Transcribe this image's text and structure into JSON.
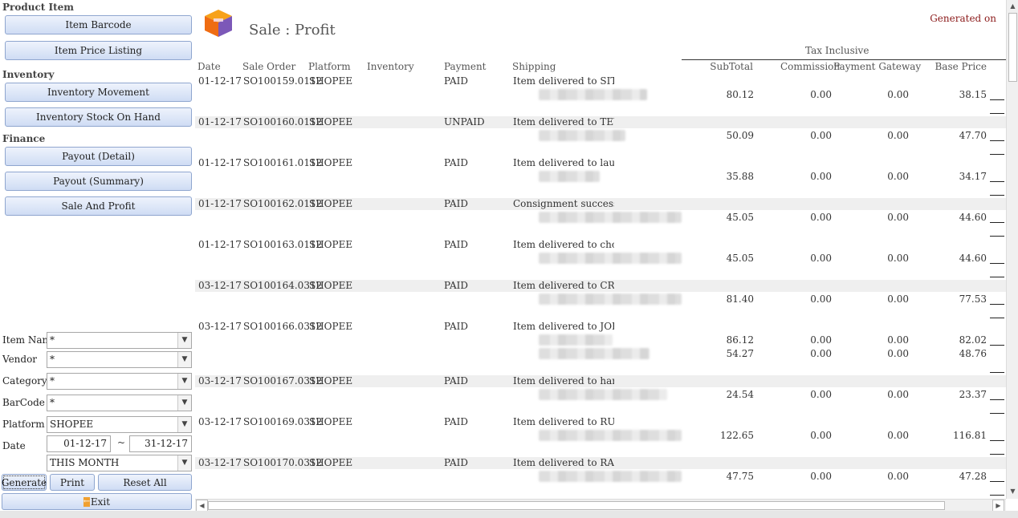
{
  "sidebar": {
    "sections": {
      "product_item": "Product Item",
      "inventory": "Inventory",
      "finance": "Finance"
    },
    "buttons": {
      "item_barcode": "Item Barcode",
      "item_price_listing": "Item Price Listing",
      "inventory_movement": "Inventory Movement",
      "inventory_stock_on_hand": "Inventory Stock On Hand",
      "payout_detail": "Payout (Detail)",
      "payout_summary": "Payout (Summary)",
      "sale_and_profit": "Sale And Profit"
    },
    "filters": {
      "item_name": {
        "label": "Item Name",
        "value": "*"
      },
      "vendor": {
        "label": "Vendor",
        "value": "*"
      },
      "category": {
        "label": "Category",
        "value": "*"
      },
      "barcode": {
        "label": "BarCode",
        "value": "*"
      },
      "platform": {
        "label": "Platform",
        "value": "SHOPEE"
      },
      "date": {
        "label": "Date",
        "from": "01-12-17",
        "to": "31-12-17",
        "separator": "~"
      },
      "period": {
        "value": "THIS MONTH"
      }
    },
    "actions": {
      "generate": "Generate",
      "print": "Print",
      "reset_all": "Reset All",
      "exit": "Exit"
    }
  },
  "report": {
    "title": "Sale : Profit",
    "generated_on": "Generated on",
    "tax_inclusive": "Tax Inclusive",
    "columns": {
      "date": "Date",
      "sale_order": "Sale Order",
      "platform": "Platform",
      "inventory": "Inventory",
      "payment": "Payment",
      "shipping": "Shipping",
      "subtotal": "SubTotal",
      "commission": "Commission",
      "payment_gateway": "Payment Gateway",
      "base_price": "Base Price"
    },
    "rows": [
      {
        "date": "01-12-17",
        "order": "SO100159.0112",
        "platform": "SHOPEE",
        "payment": "PAID",
        "shipping": "Item delivered to SITI NU",
        "subtotal": "80.12",
        "commission": "0.00",
        "gateway": "0.00",
        "base": "38.15"
      },
      {
        "date": "01-12-17",
        "order": "SO100160.0112",
        "platform": "SHOPEE",
        "payment": "UNPAID",
        "shipping": "Item delivered to TEY LA",
        "subtotal": "50.09",
        "commission": "0.00",
        "gateway": "0.00",
        "base": "47.70"
      },
      {
        "date": "01-12-17",
        "order": "SO100161.0112",
        "platform": "SHOPEE",
        "payment": "PAID",
        "shipping": "Item delivered to lau ah ch",
        "subtotal": "35.88",
        "commission": "0.00",
        "gateway": "0.00",
        "base": "34.17"
      },
      {
        "date": "01-12-17",
        "order": "SO100162.0112",
        "platform": "SHOPEE",
        "payment": "PAID",
        "shipping": "Consignment successfully",
        "subtotal": "45.05",
        "commission": "0.00",
        "gateway": "0.00",
        "base": "44.60"
      },
      {
        "date": "01-12-17",
        "order": "SO100163.0112",
        "platform": "SHOPEE",
        "payment": "PAID",
        "shipping": "Item delivered to choo",
        "subtotal": "45.05",
        "commission": "0.00",
        "gateway": "0.00",
        "base": "44.60"
      },
      {
        "date": "03-12-17",
        "order": "SO100164.0312",
        "platform": "SHOPEE",
        "payment": "PAID",
        "shipping": "Item delivered to CRISTII",
        "subtotal": "81.40",
        "commission": "0.00",
        "gateway": "0.00",
        "base": "77.53"
      },
      {
        "date": "03-12-17",
        "order": "SO100166.0312",
        "platform": "SHOPEE",
        "payment": "PAID",
        "shipping": "Item delivered to JOKO",
        "subtotal": "86.12",
        "commission": "0.00",
        "gateway": "0.00",
        "base": "82.02",
        "subtotal2": "54.27",
        "commission2": "0.00",
        "gateway2": "0.00",
        "base2": "48.76"
      },
      {
        "date": "03-12-17",
        "order": "SO100167.0312",
        "platform": "SHOPEE",
        "payment": "PAID",
        "shipping": "Item delivered to hartini",
        "subtotal": "24.54",
        "commission": "0.00",
        "gateway": "0.00",
        "base": "23.37"
      },
      {
        "date": "03-12-17",
        "order": "SO100169.0312",
        "platform": "SHOPEE",
        "payment": "PAID",
        "shipping": "Item delivered to RUHAN",
        "subtotal": "122.65",
        "commission": "0.00",
        "gateway": "0.00",
        "base": "116.81"
      },
      {
        "date": "03-12-17",
        "order": "SO100170.0312",
        "platform": "SHOPEE",
        "payment": "PAID",
        "shipping": "Item delivered to RAINNI",
        "subtotal": "47.75",
        "commission": "0.00",
        "gateway": "0.00",
        "base": "47.28"
      }
    ]
  },
  "colors": {
    "accent": "#cfdcf4",
    "generated_text": "#8b1a1a",
    "row_shade": "#efefef"
  },
  "icons": {
    "logo": "box-logo-icon",
    "exit": "exit-arrow-icon"
  }
}
